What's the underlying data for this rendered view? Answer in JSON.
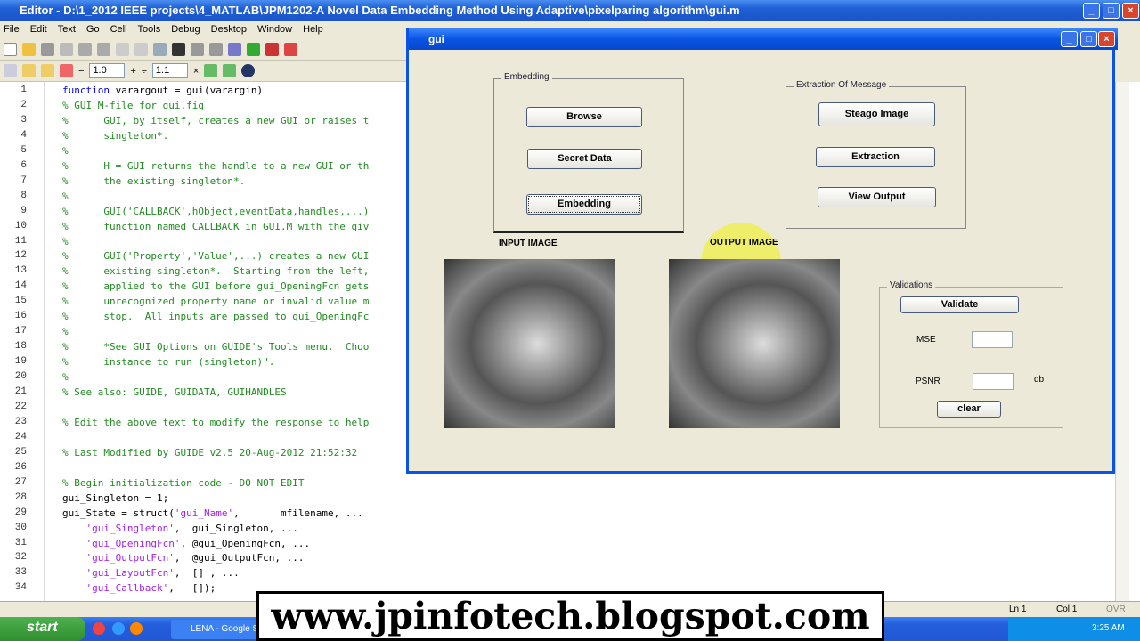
{
  "editor": {
    "title": "Editor - D:\\1_2012 IEEE projects\\4_MATLAB\\JPM1202-A Novel Data Embedding Method Using Adaptive\\pixelparing algorithm\\gui.m",
    "menu": [
      "File",
      "Edit",
      "Text",
      "Go",
      "Cell",
      "Tools",
      "Debug",
      "Desktop",
      "Window",
      "Help"
    ],
    "cell_minus": "−",
    "cell_value1": "1.0",
    "cell_plus": "+",
    "cell_divide": "÷",
    "cell_value2": "1.1",
    "cell_times": "×",
    "lines": [
      {
        "n": "1",
        "t": "function varargout = gui(varargin)",
        "k": "fn"
      },
      {
        "n": "2",
        "t": "% GUI M-file for gui.fig",
        "k": "cm"
      },
      {
        "n": "3",
        "t": "%      GUI, by itself, creates a new GUI or raises t",
        "k": "cm"
      },
      {
        "n": "4",
        "t": "%      singleton*.",
        "k": "cm"
      },
      {
        "n": "5",
        "t": "%",
        "k": "cm"
      },
      {
        "n": "6",
        "t": "%      H = GUI returns the handle to a new GUI or th",
        "k": "cm"
      },
      {
        "n": "7",
        "t": "%      the existing singleton*.",
        "k": "cm"
      },
      {
        "n": "8",
        "t": "%",
        "k": "cm"
      },
      {
        "n": "9",
        "t": "%      GUI('CALLBACK',hObject,eventData,handles,...)",
        "k": "cm"
      },
      {
        "n": "10",
        "t": "%      function named CALLBACK in GUI.M with the giv",
        "k": "cm"
      },
      {
        "n": "11",
        "t": "%",
        "k": "cm"
      },
      {
        "n": "12",
        "t": "%      GUI('Property','Value',...) creates a new GUI",
        "k": "cm"
      },
      {
        "n": "13",
        "t": "%      existing singleton*.  Starting from the left,",
        "k": "cm"
      },
      {
        "n": "14",
        "t": "%      applied to the GUI before gui_OpeningFcn gets",
        "k": "cm"
      },
      {
        "n": "15",
        "t": "%      unrecognized property name or invalid value m",
        "k": "cm"
      },
      {
        "n": "16",
        "t": "%      stop.  All inputs are passed to gui_OpeningFc",
        "k": "cm"
      },
      {
        "n": "17",
        "t": "%",
        "k": "cm"
      },
      {
        "n": "18",
        "t": "%      *See GUI Options on GUIDE's Tools menu.  Choo",
        "k": "cm"
      },
      {
        "n": "19",
        "t": "%      instance to run (singleton)\".",
        "k": "cm"
      },
      {
        "n": "20",
        "t": "%",
        "k": "cm"
      },
      {
        "n": "21",
        "t": "% See also: GUIDE, GUIDATA, GUIHANDLES",
        "k": "cm"
      },
      {
        "n": "22",
        "t": "",
        "k": "cm"
      },
      {
        "n": "23",
        "t": "% Edit the above text to modify the response to help",
        "k": "cm"
      },
      {
        "n": "24",
        "t": "",
        "k": "cm"
      },
      {
        "n": "25",
        "t": "% Last Modified by GUIDE v2.5 20-Aug-2012 21:52:32",
        "k": "cm"
      },
      {
        "n": "26",
        "t": "",
        "k": "cm"
      },
      {
        "n": "27",
        "t": "% Begin initialization code - DO NOT EDIT",
        "k": "cm"
      },
      {
        "n": "28",
        "t": "gui_Singleton = 1;",
        "k": "code"
      },
      {
        "n": "29",
        "t": "gui_State = struct('gui_Name',       mfilename, ...",
        "k": "code"
      },
      {
        "n": "30",
        "t": "    'gui_Singleton',  gui_Singleton, ...",
        "k": "code"
      },
      {
        "n": "31",
        "t": "    'gui_OpeningFcn', @gui_OpeningFcn, ...",
        "k": "code"
      },
      {
        "n": "32",
        "t": "    'gui_OutputFcn',  @gui_OutputFcn, ...",
        "k": "code"
      },
      {
        "n": "33",
        "t": "    'gui_LayoutFcn',  [] , ...",
        "k": "code"
      },
      {
        "n": "34",
        "t": "    'gui_Callback',   []);",
        "k": "code"
      }
    ],
    "status": {
      "ln": "Ln  1",
      "col": "Col  1",
      "ovr": "OVR"
    }
  },
  "gui": {
    "title": "gui",
    "embedding": {
      "label": "Embedding",
      "browse": "Browse",
      "secret": "Secret Data",
      "embed": "Embedding"
    },
    "extraction": {
      "label": "Extraction Of Message",
      "stego": "Steago Image",
      "extract": "Extraction",
      "view": "View Output"
    },
    "input_label": "INPUT IMAGE",
    "output_label": "OUTPUT IMAGE",
    "validations": {
      "label": "Validations",
      "validate": "Validate",
      "mse": "MSE",
      "psnr": "PSNR",
      "unit": "db",
      "clear": "clear",
      "mse_value": "",
      "psnr_value": ""
    }
  },
  "taskbar": {
    "start": "start",
    "task": "LENA - Google S",
    "time": "3:25 AM"
  },
  "watermark": "www.jpinfotech.blogspot.com"
}
